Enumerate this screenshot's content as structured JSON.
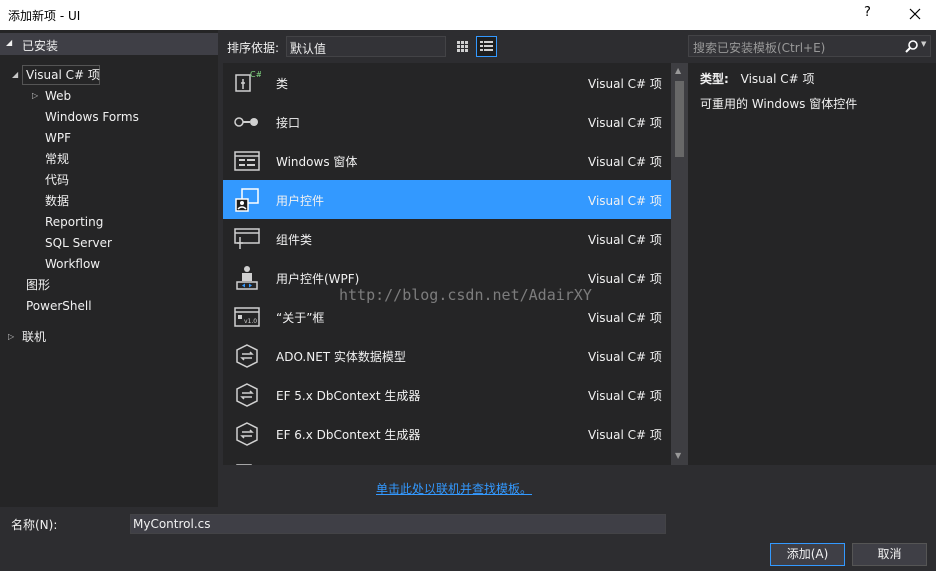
{
  "window": {
    "title": "添加新项 - UI",
    "help_label": "?"
  },
  "left_panel": {
    "section_header": "已安装",
    "tree": [
      {
        "label": "Visual C# 项",
        "expander": "◢"
      },
      {
        "label": "Web",
        "expander": "▷"
      },
      {
        "label": "Windows Forms"
      },
      {
        "label": "WPF"
      },
      {
        "label": "常规"
      },
      {
        "label": "代码"
      },
      {
        "label": "数据"
      },
      {
        "label": "Reporting"
      },
      {
        "label": "SQL Server"
      },
      {
        "label": "Workflow"
      },
      {
        "label": "图形"
      },
      {
        "label": "PowerShell"
      }
    ],
    "online_label": "联机",
    "online_expander": "▷"
  },
  "sortbar": {
    "label": "排序依据:",
    "selected": "默认值"
  },
  "templates": [
    {
      "name": "类",
      "lang": "Visual C# 项",
      "icon": "class-icon"
    },
    {
      "name": "接口",
      "lang": "Visual C# 项",
      "icon": "interface-icon"
    },
    {
      "name": "Windows 窗体",
      "lang": "Visual C# 项",
      "icon": "windows-form-icon"
    },
    {
      "name": "用户控件",
      "lang": "Visual C# 项",
      "icon": "user-control-icon",
      "selected": true
    },
    {
      "name": "组件类",
      "lang": "Visual C# 项",
      "icon": "component-class-icon"
    },
    {
      "name": "用户控件(WPF)",
      "lang": "Visual C# 项",
      "icon": "wpf-user-control-icon"
    },
    {
      "name": "“关于”框",
      "lang": "Visual C# 项",
      "icon": "about-box-icon"
    },
    {
      "name": "ADO.NET 实体数据模型",
      "lang": "Visual C# 项",
      "icon": "entity-model-icon"
    },
    {
      "name": "EF 5.x DbContext 生成器",
      "lang": "Visual C# 项",
      "icon": "dbcontext-icon"
    },
    {
      "name": "EF 6.x DbContext 生成器",
      "lang": "Visual C# 项",
      "icon": "dbcontext-icon"
    }
  ],
  "watermark": "http://blog.csdn.net/AdairXY",
  "search": {
    "placeholder": "搜索已安装模板(Ctrl+E)"
  },
  "details": {
    "type_label": "类型:",
    "type_value": "Visual C# 项",
    "description": "可重用的 Windows 窗体控件"
  },
  "online_link": "单击此处以联机并查找模板。",
  "name_field": {
    "label": "名称(N):",
    "value": "MyControl.cs"
  },
  "buttons": {
    "add": "添加(A)",
    "cancel": "取消"
  },
  "colors": {
    "accent": "#3399ff",
    "background": "#2d2d30",
    "panel": "#252526"
  }
}
